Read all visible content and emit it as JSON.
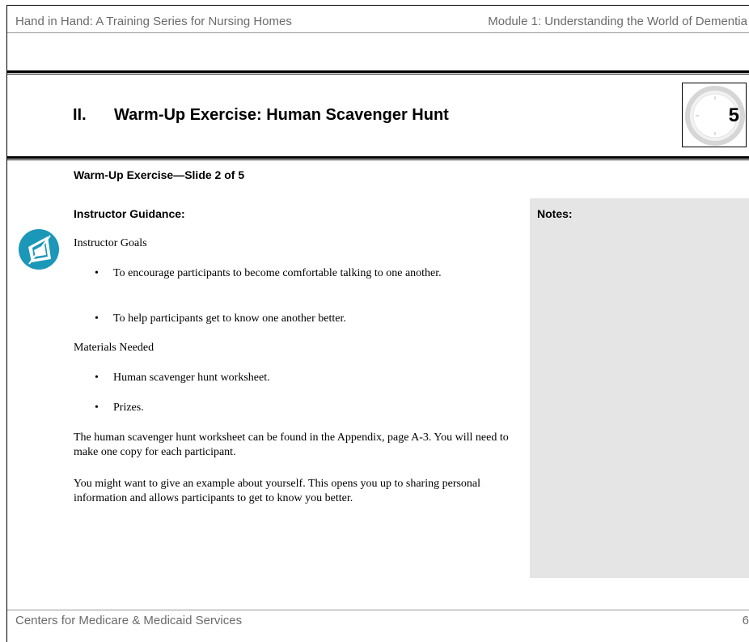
{
  "header": {
    "left": "Hand in Hand: A Training Series for Nursing Homes",
    "right": "Module 1: Understanding the World of Dementia"
  },
  "section": {
    "number": "II.",
    "title": "Warm-Up Exercise: Human Scavenger Hunt",
    "minutes": "5"
  },
  "slide_label": "Warm-Up Exercise—Slide 2 of 5",
  "guidance": {
    "heading": "Instructor Guidance:",
    "goals_heading": "Instructor Goals",
    "goals": [
      "To encourage participants to become comfortable talking to one another.",
      "To help participants get to know one another better."
    ],
    "materials_heading": "Materials Needed",
    "materials": [
      "Human scavenger hunt worksheet.",
      "Prizes."
    ],
    "paragraphs": [
      "The human scavenger hunt worksheet can be found in the Appendix, page A-3. You will need to make one copy for each participant.",
      "You might want to give an example about yourself. This opens you up to sharing personal information and allows participants to get to know you better."
    ]
  },
  "notes": {
    "heading": "Notes:"
  },
  "footer": {
    "left": "Centers for Medicare & Medicaid Services",
    "page": "6"
  },
  "colors": {
    "icon_teal": "#1b97b8",
    "notes_bg": "#e5e5e5",
    "header_gray": "#6b6b6b"
  },
  "icons": {
    "guidance": "instructor-guidance-icon",
    "clock": "clock-icon"
  }
}
